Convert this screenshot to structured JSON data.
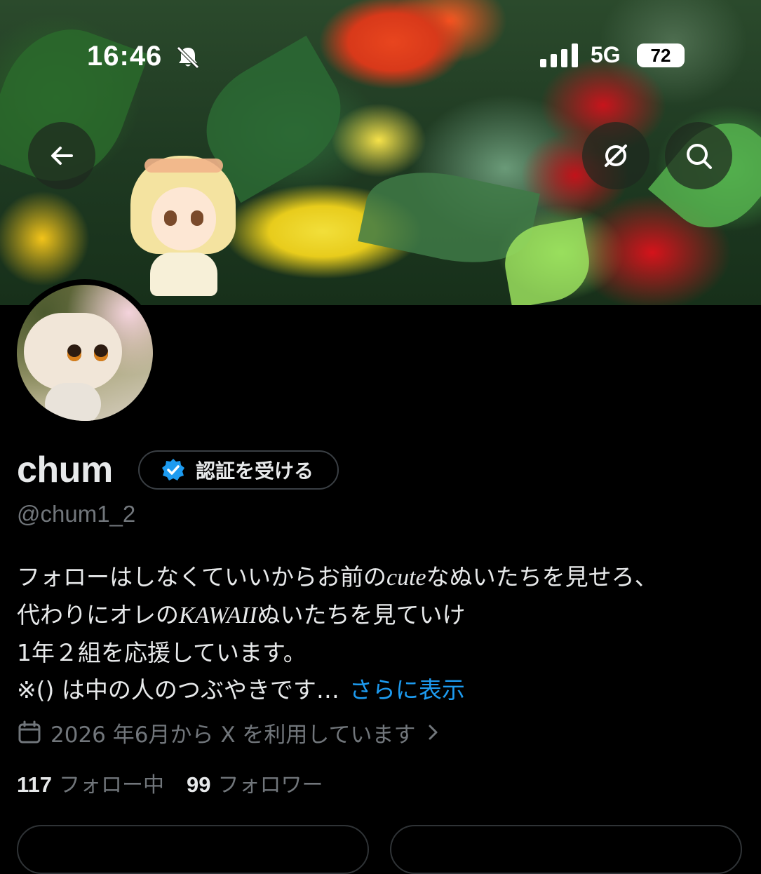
{
  "status_bar": {
    "time": "16:46",
    "network": "5G",
    "battery": "72",
    "icons": [
      "bell-slash-icon",
      "signal-bars-icon"
    ]
  },
  "header": {
    "back_icon": "arrow-left-icon",
    "grok_icon": "slashed-circle-icon",
    "search_icon": "search-icon"
  },
  "profile": {
    "name": "chum",
    "verify_label": "認証を受ける",
    "verify_icon": "verified-badge-icon",
    "handle": "@chum1_2",
    "bio": {
      "line1_pre": "フォローはしなくていいからお前の",
      "line1_it": "cute",
      "line1_post": "なぬいたちを見せろ、",
      "line2_pre": "代わりにオレの",
      "line2_it": "KAWAII",
      "line2_post": "ぬいたちを見ていけ",
      "line3": "1年２組を応援しています。",
      "line4": "※() は中の人のつぶやきです…",
      "more": "さらに表示"
    },
    "joined": "2026 年6月から X を利用しています",
    "joined_icon": "calendar-icon",
    "following_count": "117",
    "following_label": "フォロー中",
    "followers_count": "99",
    "followers_label": "フォロワー"
  },
  "colors": {
    "background": "#000000",
    "text": "#e7e9ea",
    "secondary_text": "#71767b",
    "link": "#1d9bf0",
    "verified_badge": "#1d9bf0"
  }
}
